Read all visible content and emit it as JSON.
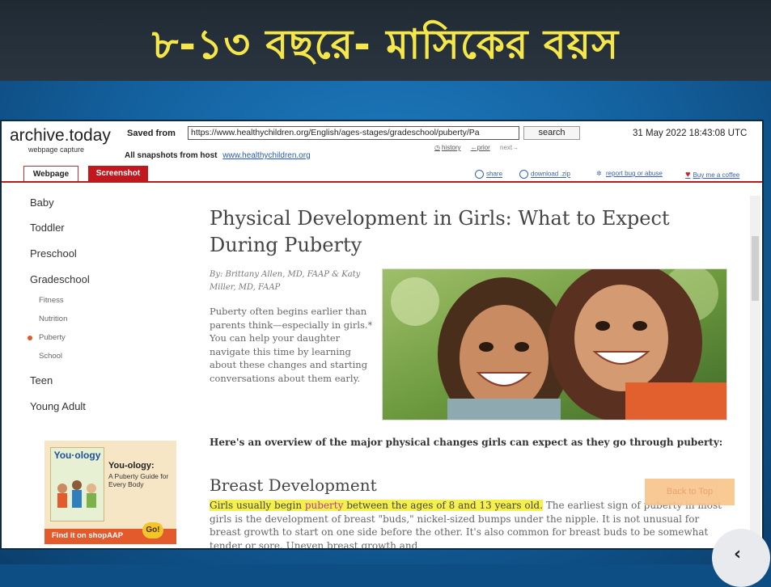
{
  "banner": {
    "title": "৮-১৩ বছরে- মাসিকের বয়স"
  },
  "archive": {
    "brand": "archive.today",
    "brand_sub": "webpage capture",
    "saved_from_label": "Saved from",
    "url_value": "https://www.healthychildren.org/English/ages-stages/gradeschool/puberty/Pa",
    "search_label": "search",
    "date": "31 May 2022 18:43:08 UTC",
    "history": "history",
    "prior": "←prior",
    "next": "next→",
    "all_snapshots_label": "All snapshots",
    "from_host": "from host",
    "host": "www.healthychildren.org",
    "tabs": [
      "Webpage",
      "Screenshot"
    ],
    "tools": {
      "share": "share",
      "download": "download .zip",
      "report": "report bug or abuse",
      "coffee": "Buy me a coffee"
    }
  },
  "nav": {
    "items": [
      "Baby",
      "Toddler",
      "Preschool",
      "Gradeschool"
    ],
    "sub_items": [
      "Fitness",
      "Nutrition",
      "Puberty",
      "School"
    ],
    "items_after": [
      "Teen",
      "Young Adult"
    ],
    "active_sub": "Puberty"
  },
  "article": {
    "title": "Physical Development in Girls: What to Expect During Puberty",
    "byline": "By: Brittany Allen, MD, FAAP & Katy Miller, MD, FAAP",
    "intro": "Puberty often begins earlier than parents think—especially in girls.* You can help your daughter navigate this time by learning about these changes and starting conversations about them early.",
    "overview": "Here's an overview of the major physical changes girls can expect as they go through puberty:",
    "section_heading": "Breast Development",
    "para_hl_a": "Girls usually begin ",
    "para_hl_b": "puberty",
    "para_hl_c": " between the ages of 8 and 13 years old.",
    "para_rest": " The earliest sign of puberty in most girls is the development of breast \"buds,\" nickel-sized bumps under the nipple. It is not unusual for breast growth to start on one side before the other. It's also common for breast buds to be somewhat tender or sore. Uneven breast growth and",
    "back_to_top": "Back to Top"
  },
  "ad": {
    "book_title": "You·ology",
    "title": "You-ology:",
    "subtitle": "A Puberty Guide for Every Body",
    "cta": "Find it on shopAAP",
    "go": "Go!"
  },
  "colors": {
    "accent_red": "#c0181c",
    "highlight": "#f5f04a",
    "banner_text": "#f5e64a"
  },
  "icons": [
    "clock-icon",
    "share-icon",
    "cloud-download-icon",
    "bug-icon",
    "heart-icon",
    "chevron-left-icon"
  ]
}
